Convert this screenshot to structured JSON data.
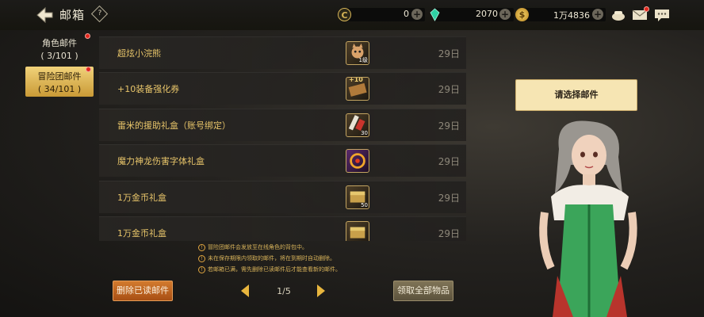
{
  "header": {
    "title": "邮箱",
    "help_label": "?"
  },
  "currencies": [
    {
      "name": "cera",
      "icon": "c-coin-icon",
      "value": "0",
      "color": "#d6b456"
    },
    {
      "name": "gem",
      "icon": "crystal-icon",
      "value": "2070",
      "color": "#2fd0a4"
    },
    {
      "name": "gold",
      "icon": "gold-coin-icon",
      "value": "1万4836",
      "color": "#e8b83a"
    }
  ],
  "top_icons": [
    "treasure-pot-icon",
    "mail-envelope-icon",
    "chat-icon"
  ],
  "sidebar": {
    "tabs": [
      {
        "name": "角色邮件",
        "count": "( 3/101 )"
      },
      {
        "name": "冒险团邮件",
        "count": "( 34/101 )"
      }
    ]
  },
  "mails": [
    {
      "title": "超炫小浣熊",
      "date": "29日",
      "thumb_icon": "raccoon-icon",
      "badge": "1级",
      "top": ""
    },
    {
      "title": "+10装备强化券",
      "date": "29日",
      "thumb_icon": "upgrade-ticket-icon",
      "badge": "",
      "top": "+10"
    },
    {
      "title": "雷米的援助礼盒（账号绑定）",
      "date": "29日",
      "thumb_icon": "gift-box-icon",
      "badge": "30",
      "top": ""
    },
    {
      "title": "魔力神龙伤害字体礼盒",
      "date": "29日",
      "thumb_icon": "dragon-font-box-icon",
      "badge": "",
      "top": ""
    },
    {
      "title": "1万金币礼盒",
      "date": "29日",
      "thumb_icon": "gold-chest-icon",
      "badge": "50",
      "top": ""
    },
    {
      "title": "1万金币礼盒",
      "date": "29日",
      "thumb_icon": "gold-chest-icon",
      "badge": "",
      "top": ""
    }
  ],
  "notices": [
    "冒险团邮件会发放至在线角色的背包中。",
    "未在保存期限内领取的邮件，将在到期时自动删除。",
    "若邮箱已满，需先删除已读邮件后才能查看新的邮件。"
  ],
  "buttons": {
    "delete_read": "删除已读邮件",
    "collect_all": "领取全部物品"
  },
  "pager": {
    "current": "1/5"
  },
  "prompt": "请选择邮件",
  "accent_color": "#e8c56a"
}
